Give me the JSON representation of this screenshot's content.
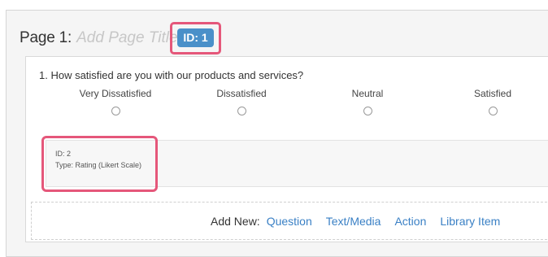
{
  "page": {
    "label": "Page 1:",
    "title_placeholder": "Add Page Title",
    "id_badge": "ID: 1"
  },
  "question": {
    "text": "1. How satisfied are you with our products and services?",
    "options": [
      "Very Dissatisfied",
      "Dissatisfied",
      "Neutral",
      "Satisfied"
    ],
    "meta_id": "ID: 2",
    "meta_type": "Type: Rating (Likert Scale)"
  },
  "add_new": {
    "label": "Add New:",
    "links": [
      "Question",
      "Text/Media",
      "Action",
      "Library Item"
    ]
  },
  "colors": {
    "accent": "#4a90c9",
    "highlight": "#e5577a",
    "link": "#3a80c5"
  }
}
